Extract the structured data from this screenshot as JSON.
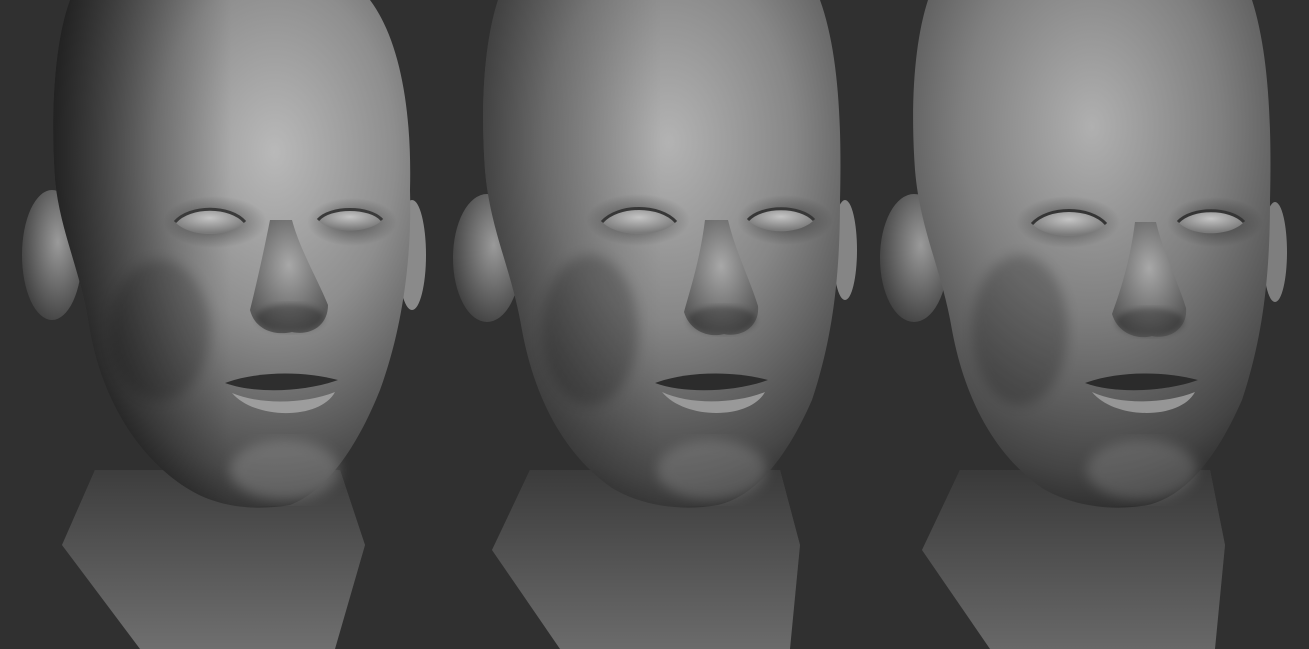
{
  "scene": {
    "background_color": "#303030",
    "material_color": "#8f8f8f",
    "views": [
      {
        "name": "three-quarter-left",
        "light": "top-left"
      },
      {
        "name": "three-quarter-front",
        "light": "top"
      },
      {
        "name": "three-quarter-right",
        "light": "top-right"
      }
    ]
  }
}
